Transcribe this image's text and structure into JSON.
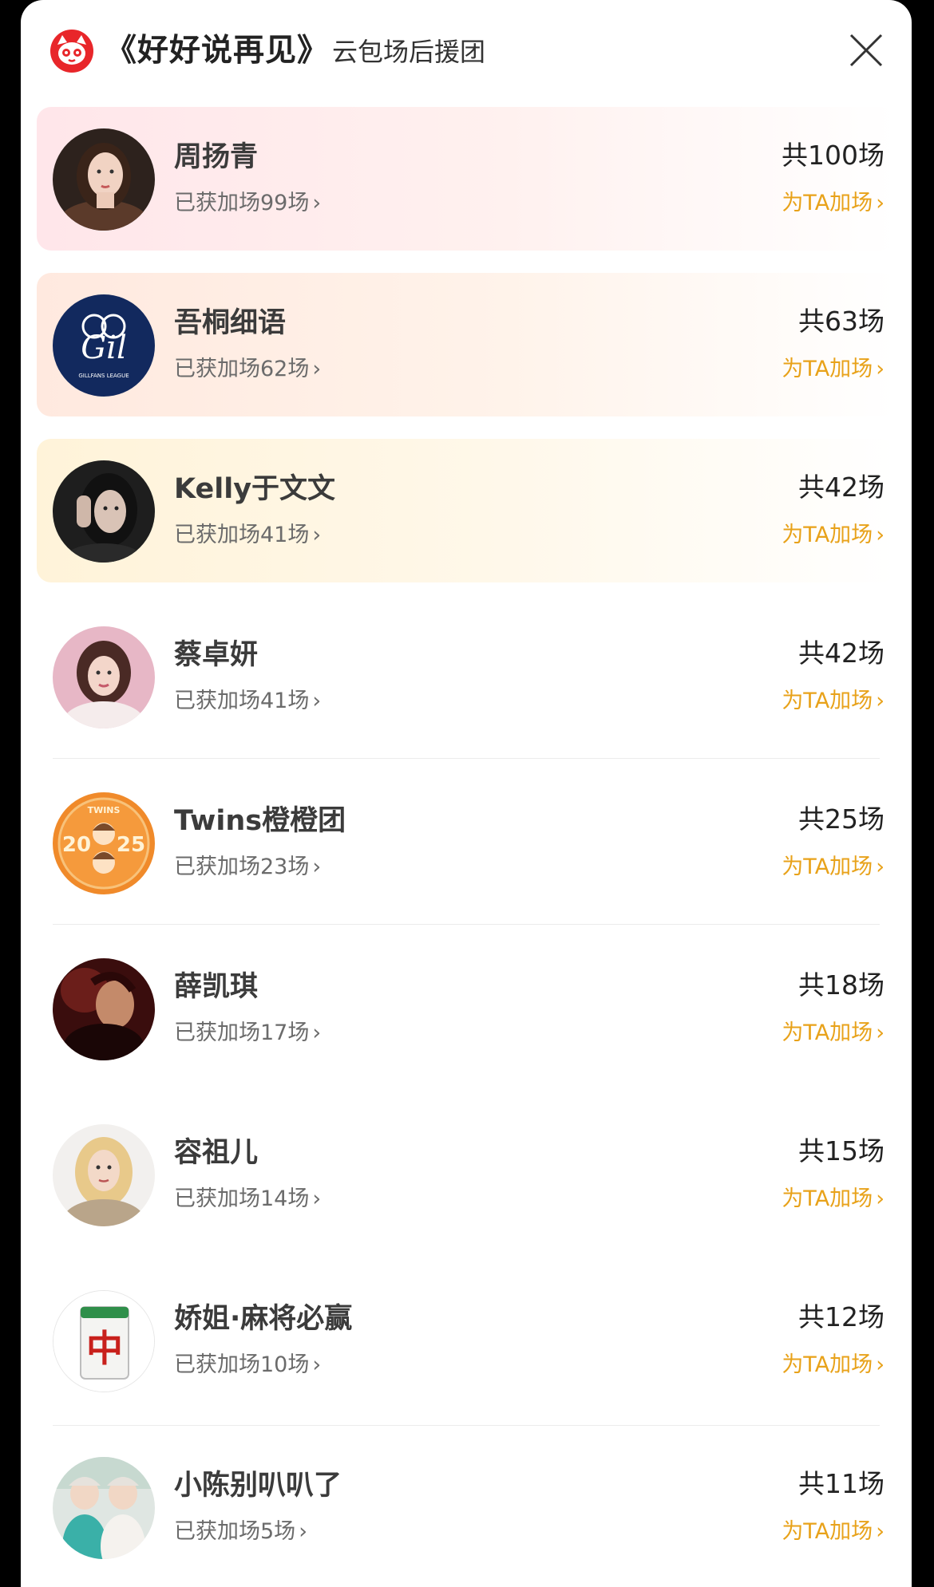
{
  "header": {
    "title": "《好好说再见》",
    "subtitle": "云包场后援团",
    "logo_icon": "cat-logo-icon",
    "close_icon": "close-icon"
  },
  "colors": {
    "accent": "#e8a21a",
    "name": "#3b3b3b",
    "secondary": "#6b6b6b",
    "logo_red": "#e8262a"
  },
  "items": [
    {
      "name": "周扬青",
      "gained": "已获加场99场",
      "total": "共100场",
      "action": "为TA加场"
    },
    {
      "name": "吾桐细语",
      "gained": "已获加场62场",
      "total": "共63场",
      "action": "为TA加场"
    },
    {
      "name": "Kelly于文文",
      "gained": "已获加场41场",
      "total": "共42场",
      "action": "为TA加场"
    },
    {
      "name": "蔡卓妍",
      "gained": "已获加场41场",
      "total": "共42场",
      "action": "为TA加场"
    },
    {
      "name": "Twins橙橙团",
      "gained": "已获加场23场",
      "total": "共25场",
      "action": "为TA加场"
    },
    {
      "name": "薛凯琪",
      "gained": "已获加场17场",
      "total": "共18场",
      "action": "为TA加场"
    },
    {
      "name": "容祖儿",
      "gained": "已获加场14场",
      "total": "共15场",
      "action": "为TA加场"
    },
    {
      "name": "娇姐·麻将必赢",
      "gained": "已获加场10场",
      "total": "共12场",
      "action": "为TA加场"
    },
    {
      "name": "小陈别叭叭了",
      "gained": "已获加场5场",
      "total": "共11场",
      "action": "为TA加场"
    }
  ],
  "avatar_texts": {
    "gil": "Gil",
    "gil_caption": "GILLFANS LEAGUE",
    "twins_top": "TWINS",
    "twins_year_left": "20",
    "twins_year_right": "25",
    "mahjong_tile": "中"
  }
}
